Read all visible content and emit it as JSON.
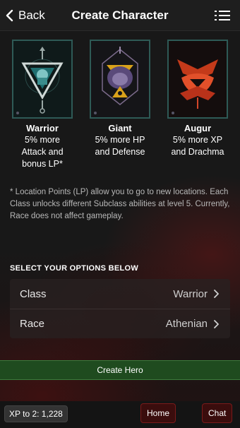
{
  "header": {
    "back_label": "Back",
    "title": "Create Character"
  },
  "classes": [
    {
      "name": "Warrior",
      "desc_lines": [
        "5% more",
        "Attack and",
        "bonus LP*"
      ]
    },
    {
      "name": "Giant",
      "desc_lines": [
        "5% more HP",
        "and Defense"
      ]
    },
    {
      "name": "Augur",
      "desc_lines": [
        "5% more XP",
        "and Drachma"
      ]
    }
  ],
  "note": "* Location Points (LP) allow you to go to new locations. Each Class unlocks different Subclass abilities at level 5. Currently, Race does not affect gameplay.",
  "options": {
    "title": "SELECT YOUR OPTIONS BELOW",
    "rows": [
      {
        "label": "Class",
        "value": "Warrior"
      },
      {
        "label": "Race",
        "value": "Athenian"
      }
    ]
  },
  "create_label": "Create Hero",
  "footer": {
    "xp": "XP to 2: 1,228",
    "home": "Home",
    "chat": "Chat"
  },
  "colors": {
    "card_border": "#2e5a56",
    "create_bg": "#1f4b1f",
    "footer_button_bg": "#3a0d0d"
  }
}
